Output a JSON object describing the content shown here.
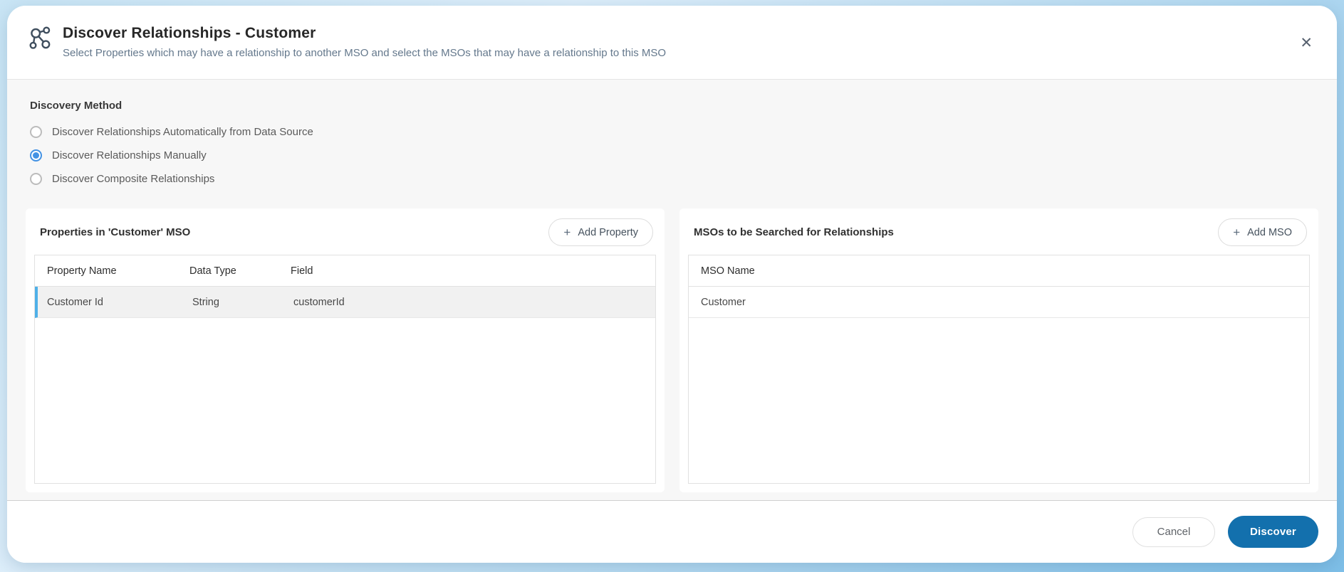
{
  "dialog": {
    "title": "Discover Relationships - Customer",
    "subtitle": "Select Properties which may have a relationship to another MSO and select the MSOs that may have a relationship to this MSO"
  },
  "icons": {
    "close": "✕",
    "plus": "+",
    "header_icon_name": "relationships-graph-icon"
  },
  "discovery_method": {
    "label": "Discovery Method",
    "options": [
      {
        "label": "Discover Relationships Automatically from Data Source",
        "selected": false
      },
      {
        "label": "Discover Relationships Manually",
        "selected": true
      },
      {
        "label": "Discover Composite Relationships",
        "selected": false
      }
    ]
  },
  "properties_panel": {
    "title": "Properties in 'Customer' MSO",
    "add_button_label": "Add Property",
    "columns": [
      "Property Name",
      "Data Type",
      "Field"
    ],
    "rows": [
      {
        "property_name": "Customer Id",
        "data_type": "String",
        "field": "customerId",
        "selected": true
      }
    ]
  },
  "msos_panel": {
    "title": "MSOs to be Searched for Relationships",
    "add_button_label": "Add MSO",
    "columns": [
      "MSO Name"
    ],
    "rows": [
      {
        "mso_name": "Customer",
        "selected": false
      }
    ]
  },
  "footer": {
    "cancel_label": "Cancel",
    "discover_label": "Discover"
  },
  "colors": {
    "primary_button": "#1370ad",
    "radio_checked": "#4392e4",
    "selected_row_accent": "#4fb0e8",
    "body_background": "#f7f7f7",
    "outer_background_top": "#c9e5f5",
    "outer_background_bottom": "#7ebfe8"
  }
}
